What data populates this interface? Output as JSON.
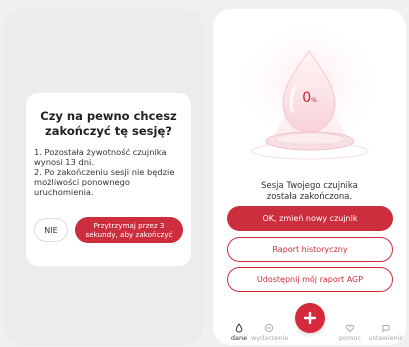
{
  "dialog": {
    "title_line1": "Czy na pewno chcesz",
    "title_line2": "zakończyć tę sesję?",
    "body_line1": "1. Pozostała żywotność czujnika",
    "body_line2": "wynosi 13 dni.",
    "body_line3": "2. Po zakończeniu sesji nie będzie",
    "body_line4": "możliwości ponownego",
    "body_line5": "uruchomienia.",
    "no_label": "NIE",
    "hold_line1": "Przytrzymaj przez 3",
    "hold_line2": "sekundy, aby zakończyć"
  },
  "status": {
    "value": "0",
    "unit": "%",
    "message_line1": "Sesja Twojego czujnika",
    "message_line2": "została zakończona."
  },
  "actions": {
    "new_sensor": "OK, zmień nowy czujnik",
    "history_report": "Raport historyczny",
    "share_agp": "Udostępnij mój raport AGP"
  },
  "nav": {
    "dane": "dane",
    "wydarzenie": "wydarzenie",
    "pomoc": "pomoc",
    "ustawienie": "ustawienie"
  },
  "colors": {
    "accent": "#cc2e3d",
    "background": "#f0f0f2"
  }
}
